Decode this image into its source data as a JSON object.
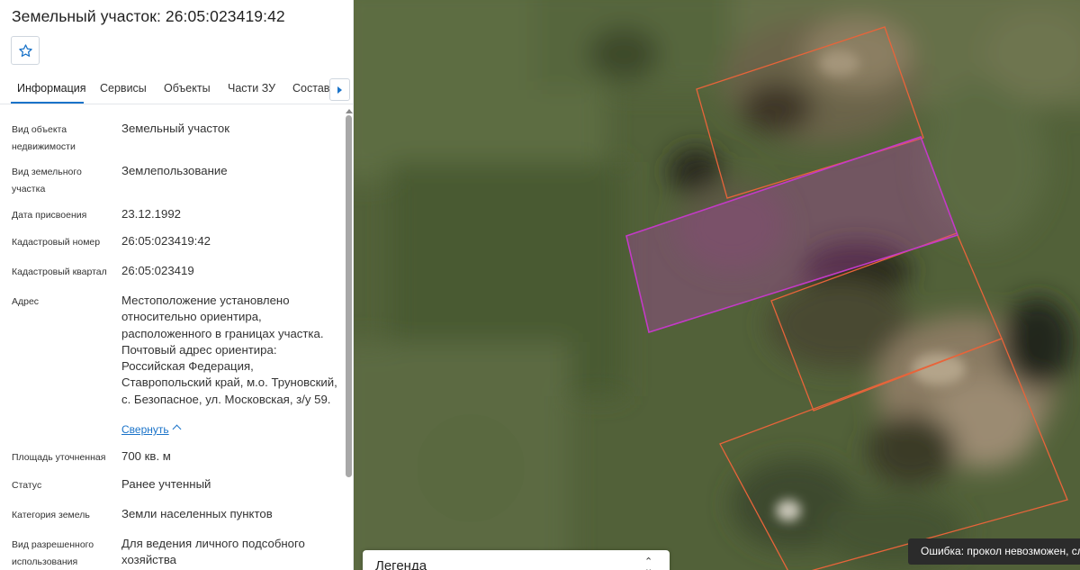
{
  "panel": {
    "title": "Земельный участок: 26:05:023419:42",
    "favorite_icon": "star-outline-icon",
    "tabs": [
      {
        "label": "Информация",
        "active": true
      },
      {
        "label": "Сервисы",
        "active": false
      },
      {
        "label": "Объекты",
        "active": false
      },
      {
        "label": "Части ЗУ",
        "active": false
      },
      {
        "label": "Состав",
        "active": false
      }
    ],
    "tab_scroll_icon": "caret-right-icon",
    "fields": [
      {
        "label": "Вид объекта недвижимости",
        "value": "Земельный участок"
      },
      {
        "label": "Вид земельного участка",
        "value": "Землепользование"
      },
      {
        "label": "Дата присвоения",
        "value": "23.12.1992"
      },
      {
        "label": "Кадастровый номер",
        "value": "26:05:023419:42"
      },
      {
        "label": "Кадастровый квартал",
        "value": "26:05:023419"
      },
      {
        "label": "Адрес",
        "value": "Местоположение установлено относительно ориентира, расположенного в границах участка. Почтовый адрес ориентира: Российская Федерация, Ставропольский край, м.о. Труновский, с. Безопасное, ул. Московская, з/у 59."
      },
      {
        "label": "Площадь уточненная",
        "value": "700 кв. м"
      },
      {
        "label": "Статус",
        "value": "Ранее учтенный"
      },
      {
        "label": "Категория земель",
        "value": "Земли населенных пунктов"
      },
      {
        "label": "Вид разрешенного использования",
        "value": "Для ведения личного подсобного хозяйства"
      }
    ],
    "collapse_link": "Свернуть"
  },
  "map": {
    "selected_parcel_color": "#c43ac8",
    "neighbor_parcel_color": "#e8643a",
    "legend": {
      "title": "Легенда"
    },
    "error_toast": "Ошибка: прокол невозможен, сл"
  },
  "colors": {
    "accent": "#1a73c9"
  }
}
